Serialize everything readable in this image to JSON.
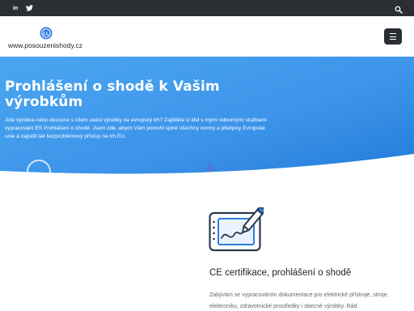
{
  "topbar": {
    "social": [
      {
        "icon": "linkedin-icon",
        "glyph": "in"
      },
      {
        "icon": "twitter-icon"
      }
    ],
    "search_icon": "search-icon"
  },
  "header": {
    "logo_icon": "logo-mark-icon",
    "logo_text": "www.posouzenishody.cz",
    "menu_icon": "hamburger-menu-icon"
  },
  "hero": {
    "title": "Prohlášení o shodě k Vašim výrobkům",
    "text": "Jste výrobce nebo dovozce s cílem uvést výrobky na evropský trh? Zajištěte si klid s mými odbornými službami vypracování ES Prohlášení o shodě. Jsem zde, abych Vám pomohl splnit všechny normy a předpisy Evropské unie a zajistili tak bezproblémový přístup na trh EU."
  },
  "feature": {
    "icon": "graphics-tablet-pen-icon",
    "title": "CE certifikace, prohlášení o shodě",
    "text": "Zabývám se vypracováním dokumentace pro elektrické přístroje, stroje, elektroniku, zdravotnické prostředky i obecné výrobky. Rád"
  },
  "colors": {
    "topbar": "#2b2f33",
    "hero_start": "#4aa6f0",
    "hero_end": "#1e78d6",
    "icon_blue": "#2f7ce0",
    "icon_dark": "#2b3a4f"
  }
}
